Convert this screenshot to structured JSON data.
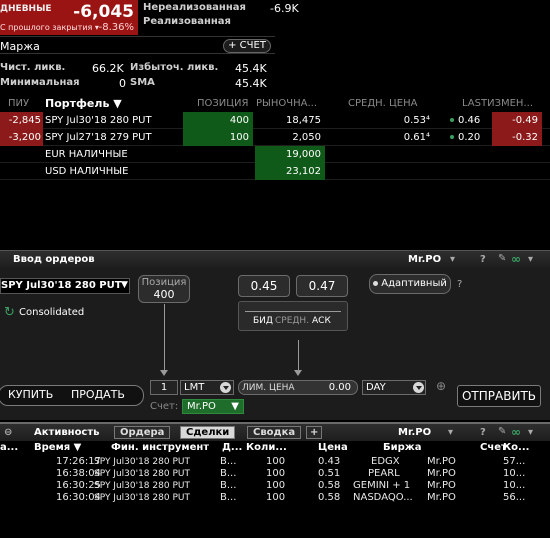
{
  "account": {
    "daily_label": "ДНЕВНЫЕ",
    "daily_value": "-6,045",
    "prev_close_label": "С прошлого закрытия",
    "daily_pct": "-8.36%",
    "unrealized_label": "Нереализованная",
    "unrealized_value": "-6.9K",
    "realized_label": "Реализованная",
    "margin_label": "Маржа",
    "account_button": "СЧЕТ",
    "net_liq_label": "Чист. ликв.",
    "net_liq_value": "66.2K",
    "excess_liq_label": "Избыточ. ликв.",
    "excess_liq_value": "45.4K",
    "min_label": "Минимальная",
    "min_value": "0",
    "sma_label": "SMA",
    "sma_value": "45.4K"
  },
  "portfolio": {
    "columns": [
      "ПИУ",
      "Портфель",
      "ПОЗИЦИЯ",
      "РЫНОЧНА...",
      "СРЕДН. ЦЕНА",
      "LASTИЗМЕН..."
    ],
    "rows": [
      {
        "pnl": "-2,845",
        "name": "SPY Jul30'18 280 PUT",
        "position": "400",
        "market": "18,475",
        "avg": "0.53⁴",
        "last": "0.46",
        "change": "-0.49"
      },
      {
        "pnl": "-3,200",
        "name": "SPY Jul27'18 279 PUT",
        "position": "100",
        "market": "2,050",
        "avg": "0.61⁴",
        "last": "0.20",
        "change": "-0.32"
      },
      {
        "pnl": "",
        "name": "EUR НАЛИЧНЫЕ",
        "position": "",
        "market": "19,000",
        "avg": "",
        "last": "",
        "change": ""
      },
      {
        "pnl": "",
        "name": "USD НАЛИЧНЫЕ",
        "position": "",
        "market": "23,102",
        "avg": "",
        "last": "",
        "change": ""
      }
    ]
  },
  "order": {
    "title": "Ввод ордеров",
    "account": "Mr.PO",
    "help": "?",
    "instrument": "SPY Jul30'18 280 PUT",
    "position_label": "Позиция",
    "position_value": "400",
    "bid": "0.45",
    "ask": "0.47",
    "bid_label": "БИД",
    "mid_label": "СРЕДН.",
    "ask_label": "АСК",
    "adaptive_label": "Адаптивный",
    "consolidated_label": "Consolidated",
    "buy_label": "КУПИТЬ",
    "sell_label": "ПРОДАТЬ",
    "quantity": "1",
    "order_type": "LMT",
    "limit_label": "ЛИМ. ЦЕНА",
    "limit_value": "0.00",
    "tif": "DAY",
    "account_label": "Счет:",
    "account_value": "Mr.PO",
    "submit_label": "ОТПРАВИТЬ"
  },
  "activity": {
    "title": "Активность",
    "tabs": [
      "Ордера",
      "Сделки",
      "Сводка"
    ],
    "active_tab": "Сделки",
    "account": "Mr.PO",
    "help": "?",
    "columns": [
      "а...",
      "Время",
      "Фин. инструмент",
      "Д...",
      "Коли...",
      "Цена",
      "Биржа",
      "Счет",
      "Ко..."
    ],
    "rows": [
      {
        "time": "17:26:17",
        "instrument": "SPY Jul30'18 280 PUT",
        "side": "B...",
        "qty": "100",
        "price": "0.43",
        "exchange": "EDGX",
        "account": "Mr.PO",
        "comm": "57..."
      },
      {
        "time": "16:38:04",
        "instrument": "SPY Jul30'18 280 PUT",
        "side": "B...",
        "qty": "100",
        "price": "0.51",
        "exchange": "PEARL",
        "account": "Mr.PO",
        "comm": "10..."
      },
      {
        "time": "16:30:25",
        "instrument": "SPY Jul30'18 280 PUT",
        "side": "B...",
        "qty": "100",
        "price": "0.58",
        "exchange": "GEMINI + 1",
        "account": "Mr.PO",
        "comm": "10..."
      },
      {
        "time": "16:30:04",
        "instrument": "SPY Jul30'18 280 PUT",
        "side": "B...",
        "qty": "100",
        "price": "0.58",
        "exchange": "NASDAQO...",
        "account": "Mr.PO",
        "comm": "56..."
      }
    ]
  },
  "colors": {
    "negative_bg": "#8c1a1a",
    "position_bg": "#0f5a18",
    "accent_green": "#3aa063"
  }
}
